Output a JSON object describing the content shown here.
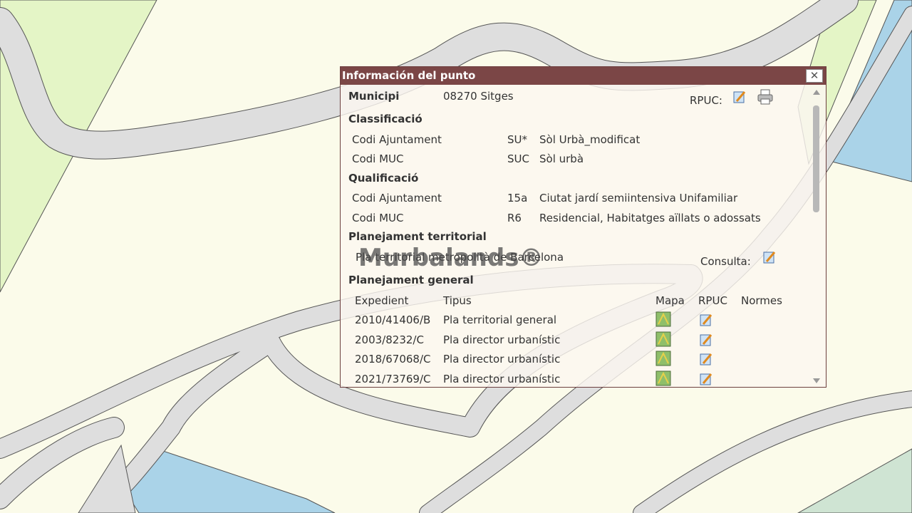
{
  "popup": {
    "title": "Información del punto",
    "close": "✕",
    "municipi_label": "Municipi",
    "municipi_value": "08270 Sitges",
    "rpuc_label": "RPUC:",
    "sections": {
      "classificacio": "Classificació",
      "qualificacio": "Qualificació",
      "planejament_territorial": "Planejament territorial",
      "planejament_general": "Planejament general"
    },
    "classificacio_rows": [
      {
        "label": "Codi Ajuntament",
        "code": "SU*",
        "desc": "Sòl Urbà_modificat"
      },
      {
        "label": "Codi MUC",
        "code": "SUC",
        "desc": "Sòl urbà"
      }
    ],
    "qualificacio_rows": [
      {
        "label": "Codi Ajuntament",
        "code": "15a",
        "desc": "Ciutat jardí semiintensiva Unifamiliar"
      },
      {
        "label": "Codi MUC",
        "code": "R6",
        "desc": "Residencial, Habitatges aïllats o adossats"
      }
    ],
    "territorial_text": "Pla territorial metropolità de Barcelona",
    "consulta_label": "Consulta:",
    "table_headers": {
      "expedient": "Expedient",
      "tipus": "Tipus",
      "mapa": "Mapa",
      "rpuc": "RPUC",
      "normes": "Normes"
    },
    "rows": [
      {
        "expedient": "2010/41406/B",
        "tipus": "Pla territorial general"
      },
      {
        "expedient": "2003/8232/C",
        "tipus": "Pla director urbanístic"
      },
      {
        "expedient": "2018/67068/C",
        "tipus": "Pla director urbanístic"
      },
      {
        "expedient": "2021/73769/C",
        "tipus": "Pla director urbanístic"
      }
    ]
  },
  "watermark": "Murbalands®",
  "colors": {
    "titlebar": "#7b4646",
    "road": "#dddddd",
    "green": "#e4f5c6",
    "water": "#aad3e8",
    "land": "#fbfbea"
  }
}
